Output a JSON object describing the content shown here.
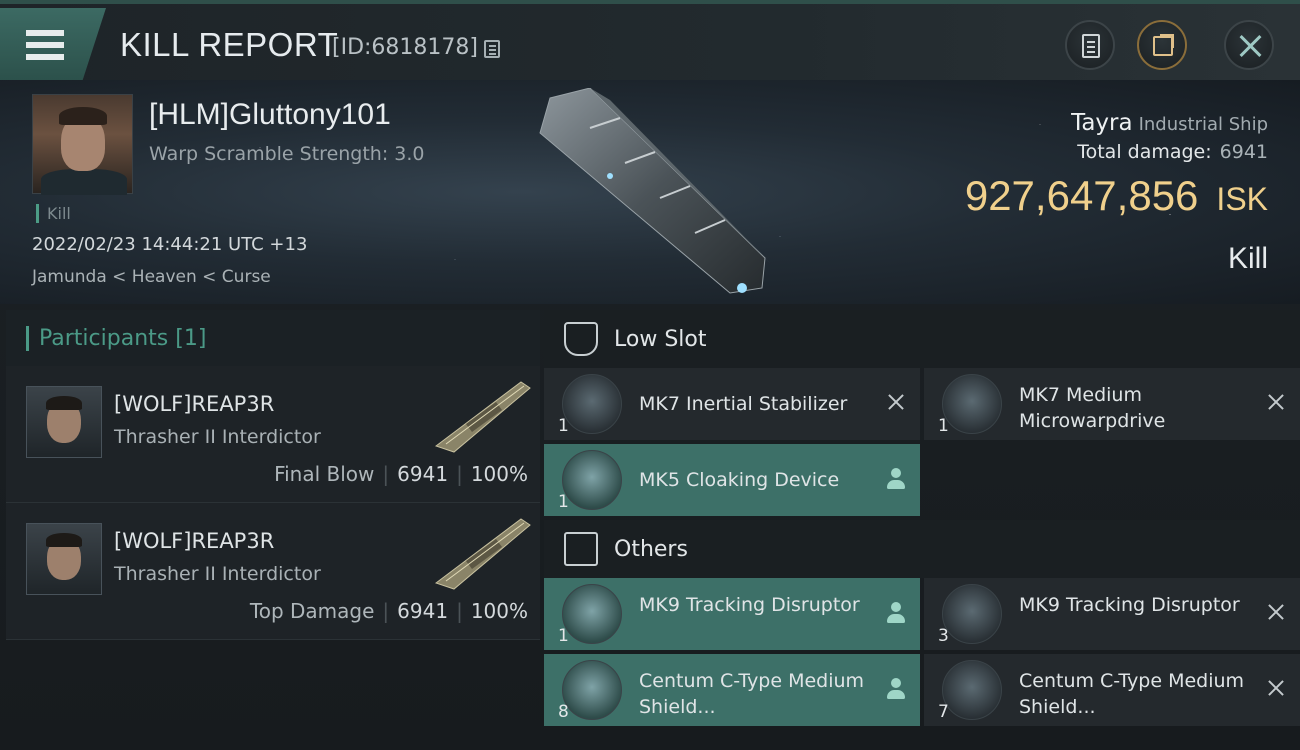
{
  "header": {
    "title": "KILL REPORT",
    "report_id": "[ID:6818178]"
  },
  "victim": {
    "name": "[HLM]Gluttony101",
    "subtitle": "Warp Scramble Strength: 3.0",
    "tag": "Kill",
    "datetime": "2022/02/23 14:44:21 UTC +13",
    "location": "Jamunda < Heaven < Curse"
  },
  "ship": {
    "name": "Tayra",
    "class": "Industrial Ship",
    "total_damage_label": "Total damage:",
    "total_damage": "6941",
    "isk_value": "927,647,856",
    "isk_unit": "ISK",
    "result": "Kill"
  },
  "participants": {
    "title": "Participants",
    "count": "[1]",
    "rows": [
      {
        "name": "[WOLF]REAP3R",
        "ship": "Thrasher II Interdictor",
        "label": "Final Blow",
        "damage": "6941",
        "percent": "100%"
      },
      {
        "name": "[WOLF]REAP3R",
        "ship": "Thrasher II Interdictor",
        "label": "Top Damage",
        "damage": "6941",
        "percent": "100%"
      }
    ]
  },
  "sections": {
    "low_slot": "Low Slot",
    "others": "Others"
  },
  "low_slot_items": [
    {
      "name": "MK7 Inertial Stabilizer",
      "qty": "1",
      "status": "destroyed"
    },
    {
      "name": "MK7 Medium Microwarpdrive",
      "qty": "1",
      "status": "destroyed"
    },
    {
      "name": "MK5 Cloaking Device",
      "qty": "1",
      "status": "dropped"
    }
  ],
  "other_items": [
    {
      "name": "MK9 Tracking Disruptor",
      "qty": "1",
      "status": "dropped"
    },
    {
      "name": "MK9 Tracking Disruptor",
      "qty": "3",
      "status": "destroyed"
    },
    {
      "name": "Centum C-Type Medium Shield...",
      "qty": "8",
      "status": "dropped"
    },
    {
      "name": "Centum C-Type Medium Shield...",
      "qty": "7",
      "status": "destroyed"
    }
  ],
  "colors": {
    "accent": "#3d7068",
    "isk": "#f0d08c",
    "participants_header": "#4b9a87"
  }
}
